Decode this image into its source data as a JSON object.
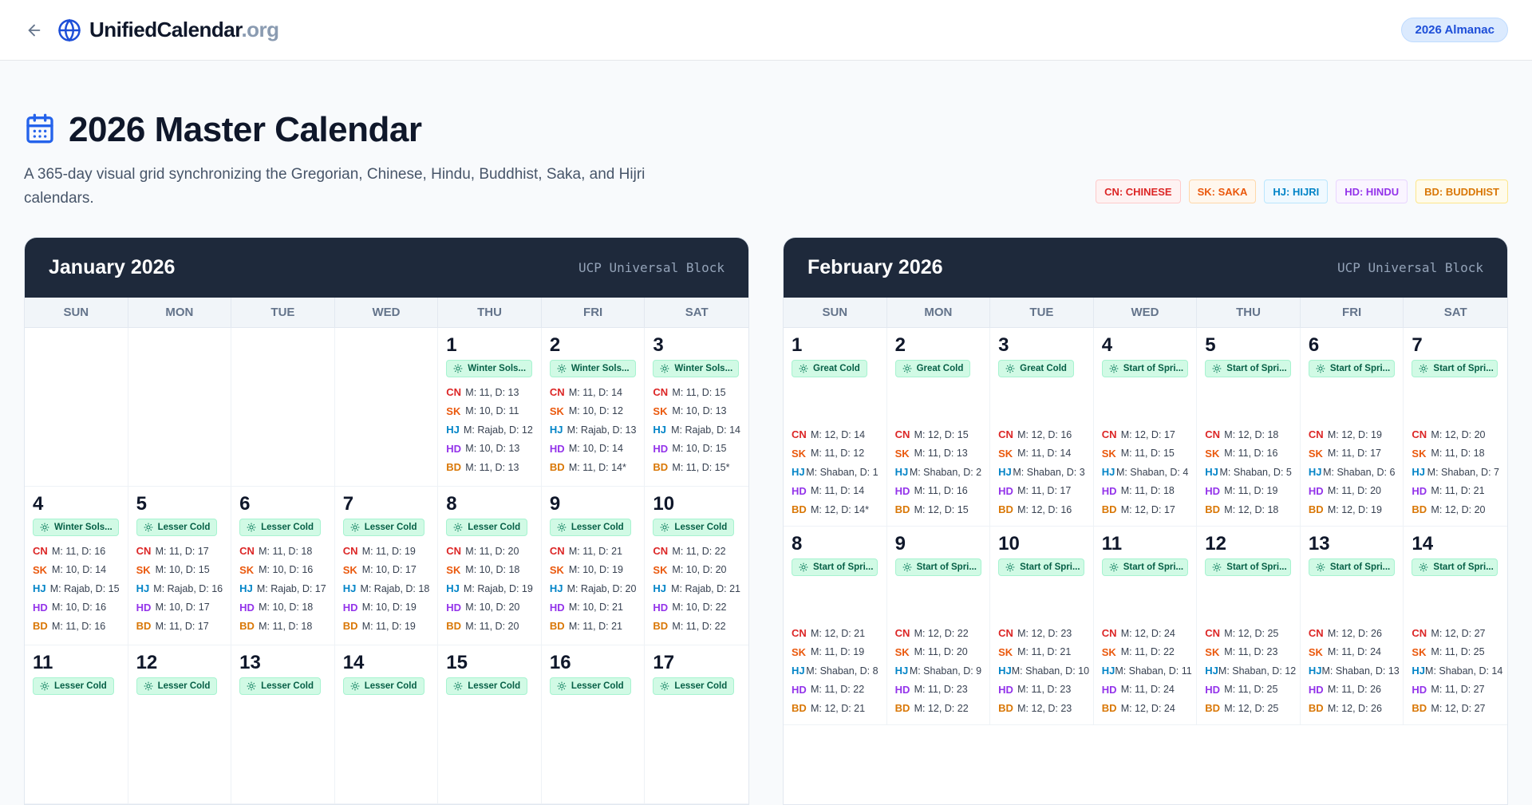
{
  "nav": {
    "brand_main": "UnifiedCalendar",
    "brand_tld": ".org",
    "almanac_label": "2026 Almanac"
  },
  "hero": {
    "title": "2026 Master Calendar",
    "subtitle": "A 365-day visual grid synchronizing the Gregorian, Chinese, Hindu, Buddhist, Saka, and Hijri calendars."
  },
  "legend": [
    {
      "label": "CN: CHINESE",
      "color": "#dc2626",
      "bg": "#fef2f2",
      "border": "#fecaca"
    },
    {
      "label": "SK: SAKA",
      "color": "#ea580c",
      "bg": "#fff7ed",
      "border": "#fed7aa"
    },
    {
      "label": "HJ: HIJRI",
      "color": "#0284c7",
      "bg": "#f0f9ff",
      "border": "#bae6fd"
    },
    {
      "label": "HD: HINDU",
      "color": "#9333ea",
      "bg": "#faf5ff",
      "border": "#e9d5ff"
    },
    {
      "label": "BD: BUDDHIST",
      "color": "#d97706",
      "bg": "#fffbeb",
      "border": "#fde68a"
    }
  ],
  "weekdays": [
    "SUN",
    "MON",
    "TUE",
    "WED",
    "THU",
    "FRI",
    "SAT"
  ],
  "cal_abbrs": [
    "CN",
    "SK",
    "HJ",
    "HD",
    "BD"
  ],
  "months": [
    {
      "key": "jan",
      "title": "January 2026",
      "block_label": "UCP Universal Block",
      "lead_blanks": 4,
      "days": [
        {
          "day": "1",
          "term": "Winter Sols...",
          "lines": [
            "M: 11, D: 13",
            "M: 10, D: 11",
            "M: Rajab, D: 12",
            "M: 10, D: 13",
            "M: 11, D: 13"
          ]
        },
        {
          "day": "2",
          "term": "Winter Sols...",
          "lines": [
            "M: 11, D: 14",
            "M: 10, D: 12",
            "M: Rajab, D: 13",
            "M: 10, D: 14",
            "M: 11, D: 14*"
          ]
        },
        {
          "day": "3",
          "term": "Winter Sols...",
          "lines": [
            "M: 11, D: 15",
            "M: 10, D: 13",
            "M: Rajab, D: 14",
            "M: 10, D: 15",
            "M: 11, D: 15*"
          ]
        },
        {
          "day": "4",
          "term": "Winter Sols...",
          "lines": [
            "M: 11, D: 16",
            "M: 10, D: 14",
            "M: Rajab, D: 15",
            "M: 10, D: 16",
            "M: 11, D: 16"
          ]
        },
        {
          "day": "5",
          "term": "Lesser Cold",
          "lines": [
            "M: 11, D: 17",
            "M: 10, D: 15",
            "M: Rajab, D: 16",
            "M: 10, D: 17",
            "M: 11, D: 17"
          ]
        },
        {
          "day": "6",
          "term": "Lesser Cold",
          "lines": [
            "M: 11, D: 18",
            "M: 10, D: 16",
            "M: Rajab, D: 17",
            "M: 10, D: 18",
            "M: 11, D: 18"
          ]
        },
        {
          "day": "7",
          "term": "Lesser Cold",
          "lines": [
            "M: 11, D: 19",
            "M: 10, D: 17",
            "M: Rajab, D: 18",
            "M: 10, D: 19",
            "M: 11, D: 19"
          ]
        },
        {
          "day": "8",
          "term": "Lesser Cold",
          "lines": [
            "M: 11, D: 20",
            "M: 10, D: 18",
            "M: Rajab, D: 19",
            "M: 10, D: 20",
            "M: 11, D: 20"
          ]
        },
        {
          "day": "9",
          "term": "Lesser Cold",
          "lines": [
            "M: 11, D: 21",
            "M: 10, D: 19",
            "M: Rajab, D: 20",
            "M: 10, D: 21",
            "M: 11, D: 21"
          ]
        },
        {
          "day": "10",
          "term": "Lesser Cold",
          "lines": [
            "M: 11, D: 22",
            "M: 10, D: 20",
            "M: Rajab, D: 21",
            "M: 10, D: 22",
            "M: 11, D: 22"
          ]
        },
        {
          "day": "11",
          "term": "Lesser Cold",
          "lines": []
        },
        {
          "day": "12",
          "term": "Lesser Cold",
          "lines": []
        },
        {
          "day": "13",
          "term": "Lesser Cold",
          "lines": []
        },
        {
          "day": "14",
          "term": "Lesser Cold",
          "lines": []
        },
        {
          "day": "15",
          "term": "Lesser Cold",
          "lines": []
        },
        {
          "day": "16",
          "term": "Lesser Cold",
          "lines": []
        },
        {
          "day": "17",
          "term": "Lesser Cold",
          "lines": []
        }
      ]
    },
    {
      "key": "feb",
      "title": "February 2026",
      "block_label": "UCP Universal Block",
      "lead_blanks": 0,
      "days": [
        {
          "day": "1",
          "term": "Great Cold",
          "lines": [
            "M: 12, D: 14",
            "M: 11, D: 12",
            "M: Shaban, D: 1",
            "M: 11, D: 14",
            "M: 12, D: 14*"
          ]
        },
        {
          "day": "2",
          "term": "Great Cold",
          "lines": [
            "M: 12, D: 15",
            "M: 11, D: 13",
            "M: Shaban, D: 2",
            "M: 11, D: 16",
            "M: 12, D: 15"
          ]
        },
        {
          "day": "3",
          "term": "Great Cold",
          "lines": [
            "M: 12, D: 16",
            "M: 11, D: 14",
            "M: Shaban, D: 3",
            "M: 11, D: 17",
            "M: 12, D: 16"
          ]
        },
        {
          "day": "4",
          "term": "Start of Spri...",
          "lines": [
            "M: 12, D: 17",
            "M: 11, D: 15",
            "M: Shaban, D: 4",
            "M: 11, D: 18",
            "M: 12, D: 17"
          ]
        },
        {
          "day": "5",
          "term": "Start of Spri...",
          "lines": [
            "M: 12, D: 18",
            "M: 11, D: 16",
            "M: Shaban, D: 5",
            "M: 11, D: 19",
            "M: 12, D: 18"
          ]
        },
        {
          "day": "6",
          "term": "Start of Spri...",
          "lines": [
            "M: 12, D: 19",
            "M: 11, D: 17",
            "M: Shaban, D: 6",
            "M: 11, D: 20",
            "M: 12, D: 19"
          ]
        },
        {
          "day": "7",
          "term": "Start of Spri...",
          "lines": [
            "M: 12, D: 20",
            "M: 11, D: 18",
            "M: Shaban, D: 7",
            "M: 11, D: 21",
            "M: 12, D: 20"
          ]
        },
        {
          "day": "8",
          "term": "Start of Spri...",
          "lines": [
            "M: 12, D: 21",
            "M: 11, D: 19",
            "M: Shaban, D: 8",
            "M: 11, D: 22",
            "M: 12, D: 21"
          ]
        },
        {
          "day": "9",
          "term": "Start of Spri...",
          "lines": [
            "M: 12, D: 22",
            "M: 11, D: 20",
            "M: Shaban, D: 9",
            "M: 11, D: 23",
            "M: 12, D: 22"
          ]
        },
        {
          "day": "10",
          "term": "Start of Spri...",
          "lines": [
            "M: 12, D: 23",
            "M: 11, D: 21",
            "M: Shaban, D: 10",
            "M: 11, D: 23",
            "M: 12, D: 23"
          ]
        },
        {
          "day": "11",
          "term": "Start of Spri...",
          "lines": [
            "M: 12, D: 24",
            "M: 11, D: 22",
            "M: Shaban, D: 11",
            "M: 11, D: 24",
            "M: 12, D: 24"
          ]
        },
        {
          "day": "12",
          "term": "Start of Spri...",
          "lines": [
            "M: 12, D: 25",
            "M: 11, D: 23",
            "M: Shaban, D: 12",
            "M: 11, D: 25",
            "M: 12, D: 25"
          ]
        },
        {
          "day": "13",
          "term": "Start of Spri...",
          "lines": [
            "M: 12, D: 26",
            "M: 11, D: 24",
            "M: Shaban, D: 13",
            "M: 11, D: 26",
            "M: 12, D: 26"
          ]
        },
        {
          "day": "14",
          "term": "Start of Spri...",
          "lines": [
            "M: 12, D: 27",
            "M: 11, D: 25",
            "M: Shaban, D: 14",
            "M: 11, D: 27",
            "M: 12, D: 27"
          ]
        }
      ]
    }
  ]
}
